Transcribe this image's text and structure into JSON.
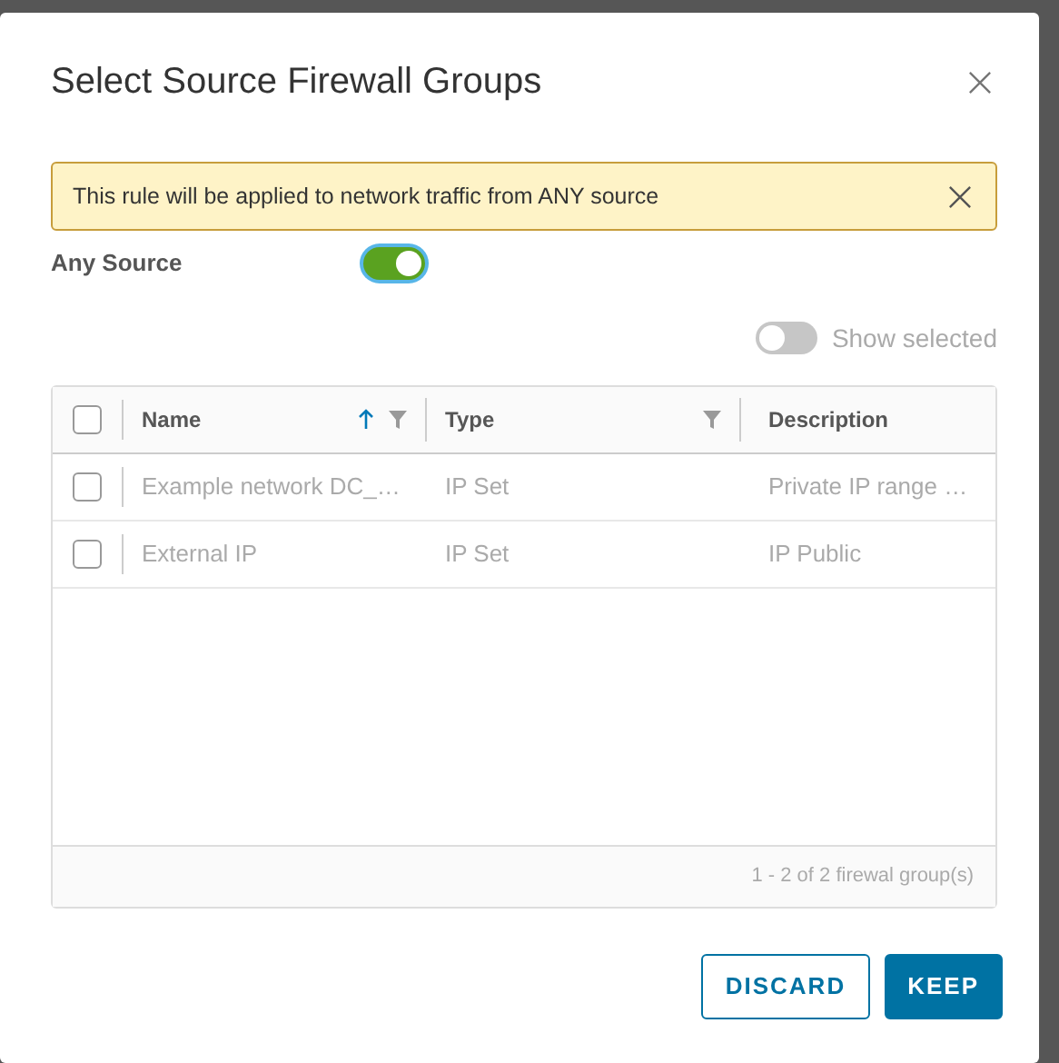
{
  "dialog": {
    "title": "Select Source Firewall Groups"
  },
  "alert": {
    "text": "This rule will be applied to network traffic from ANY source"
  },
  "any_source": {
    "label": "Any Source",
    "on": true
  },
  "show_selected": {
    "label": "Show selected",
    "on": false
  },
  "table": {
    "select_all": {
      "checked": false
    },
    "columns": [
      {
        "label": "Name",
        "sorted": true,
        "filter": true
      },
      {
        "label": "Type",
        "sorted": false,
        "filter": true
      },
      {
        "label": "Description",
        "sorted": false,
        "filter": false
      }
    ],
    "rows": [
      {
        "checked": false,
        "cells": [
          "Example network DC_…",
          "IP Set",
          "Private IP range …"
        ]
      },
      {
        "checked": false,
        "cells": [
          "External IP",
          "IP Set",
          "IP Public"
        ]
      }
    ],
    "footer": "1 - 2 of 2 firewal group(s)"
  },
  "buttons": [
    {
      "label": "DISCARD",
      "kind": "outline"
    },
    {
      "label": "KEEP",
      "kind": "solid"
    }
  ]
}
